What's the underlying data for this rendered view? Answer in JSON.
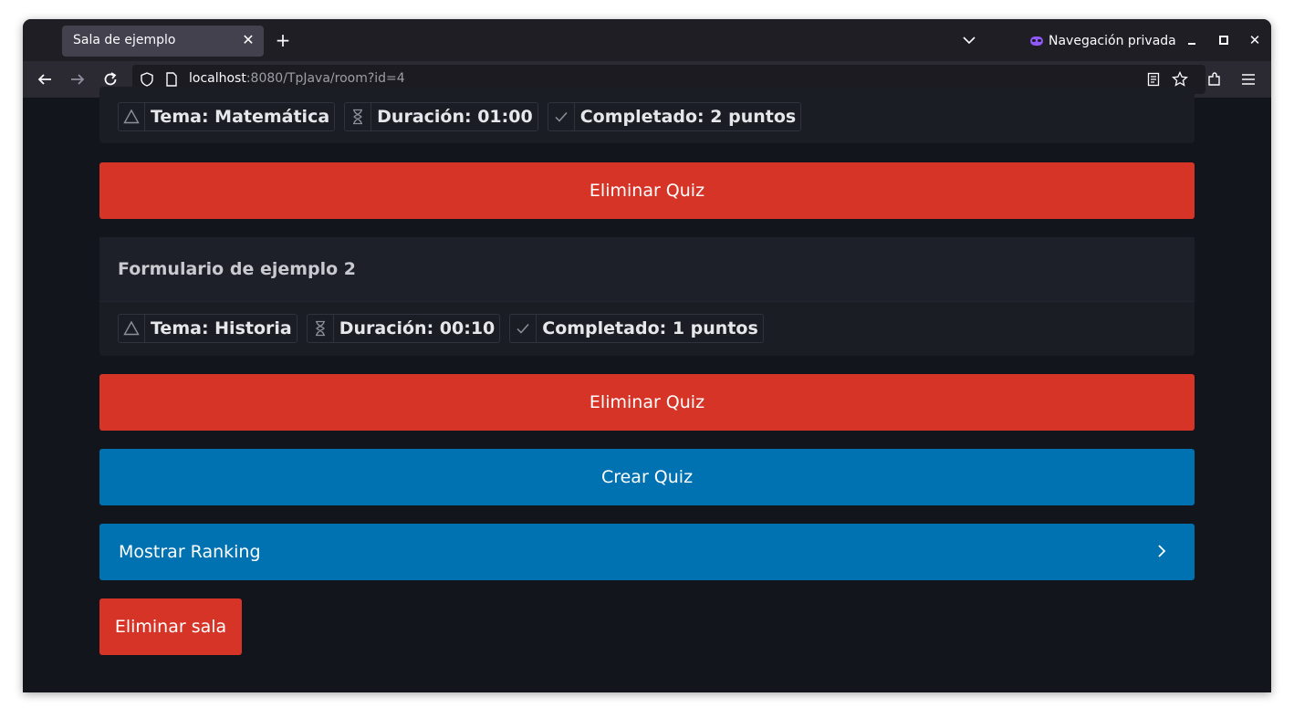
{
  "browser": {
    "tab_title": "Sala de ejemplo",
    "private_label": "Navegación privada",
    "url_host": "localhost",
    "url_rest": ":8080/TpJava/room?id=4"
  },
  "quizzes": [
    {
      "title": "",
      "tags": {
        "tema": "Tema: Matemática",
        "duracion": "Duración: 01:00",
        "completado": "Completado: 2 puntos"
      },
      "delete_label": "Eliminar Quiz"
    },
    {
      "title": "Formulario de ejemplo 2",
      "tags": {
        "tema": "Tema: Historia",
        "duracion": "Duración: 00:10",
        "completado": "Completado: 1 puntos"
      },
      "delete_label": "Eliminar Quiz"
    }
  ],
  "actions": {
    "create_quiz": "Crear Quiz",
    "show_ranking": "Mostrar Ranking",
    "delete_room": "Eliminar sala"
  },
  "colors": {
    "danger": "#d73428",
    "primary": "#0071b1",
    "page_bg": "#12151c"
  }
}
